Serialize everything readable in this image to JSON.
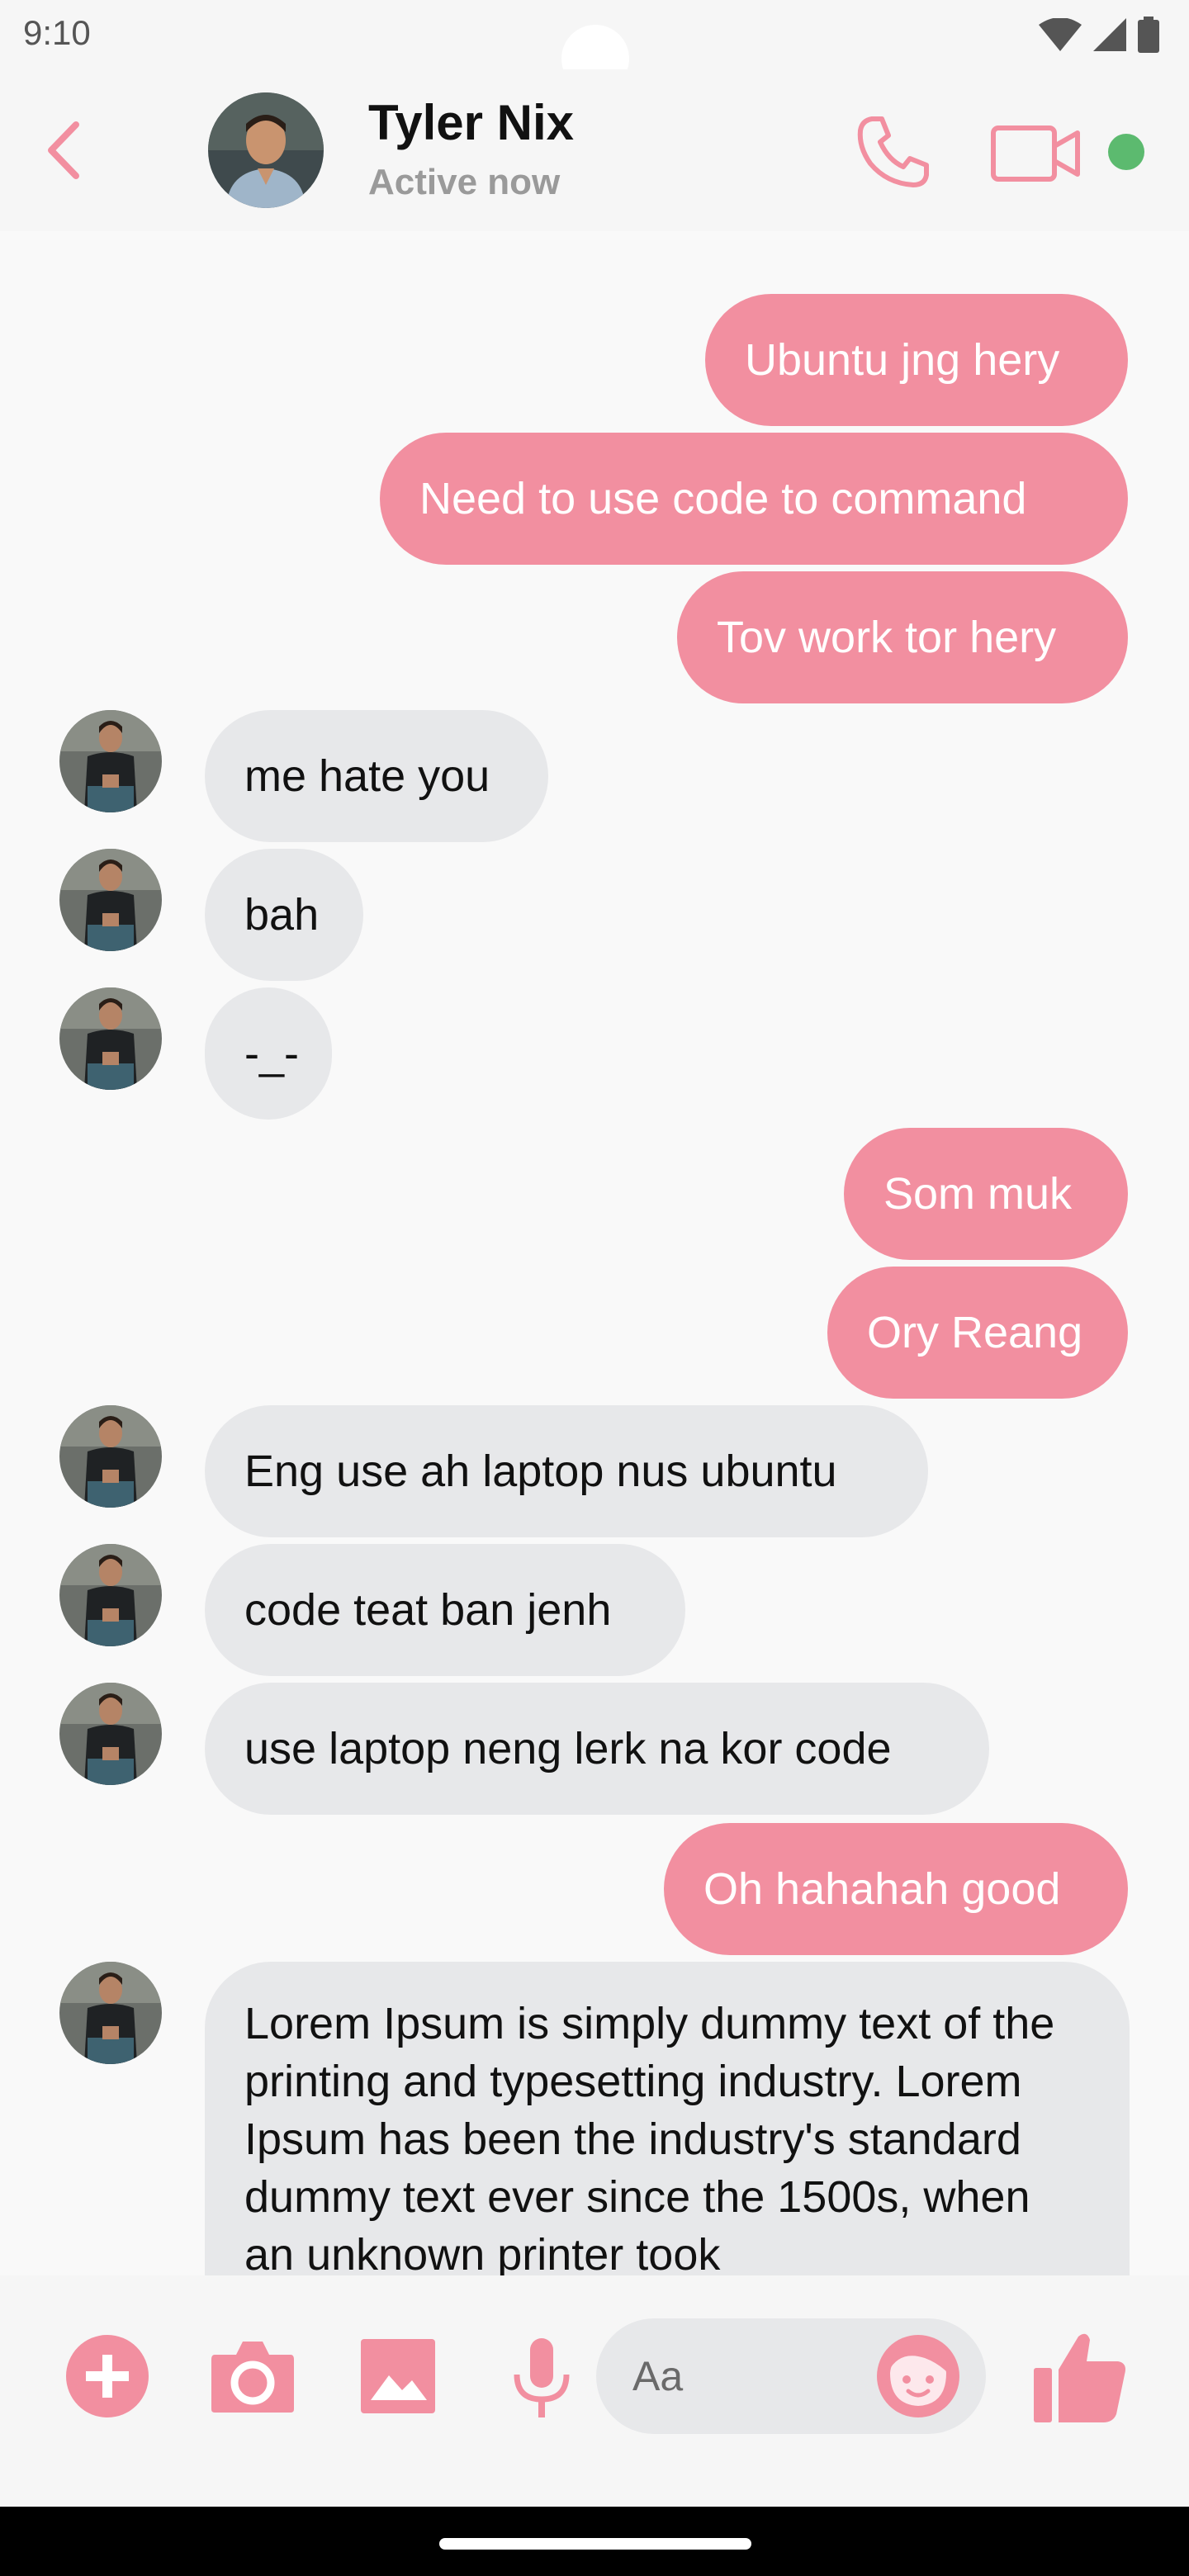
{
  "status_bar": {
    "time": "9:10"
  },
  "header": {
    "contact_name": "Tyler Nix",
    "contact_status": "Active now",
    "accent_color": "#f28fa0",
    "online_color": "#5cba6f"
  },
  "messages": [
    {
      "direction": "outgoing",
      "text": "Ubuntu jng hery"
    },
    {
      "direction": "outgoing",
      "text": "Need to use code to command"
    },
    {
      "direction": "outgoing",
      "text": "Tov work tor hery"
    },
    {
      "direction": "incoming",
      "text": "me hate you"
    },
    {
      "direction": "incoming",
      "text": "bah"
    },
    {
      "direction": "incoming",
      "text": "-_-"
    },
    {
      "direction": "outgoing",
      "text": "Som muk"
    },
    {
      "direction": "outgoing",
      "text": "Ory Reang"
    },
    {
      "direction": "incoming",
      "text": "Eng use ah laptop nus ubuntu"
    },
    {
      "direction": "incoming",
      "text": "code teat ban jenh"
    },
    {
      "direction": "incoming",
      "text": "use laptop neng lerk na kor code"
    },
    {
      "direction": "outgoing",
      "text": "Oh hahahah good"
    },
    {
      "direction": "incoming",
      "text": "Lorem Ipsum is simply dummy text of the printing and typesetting industry. Lorem Ipsum has been the industry's standard dummy text ever since the 1500s, when an unknown printer took"
    }
  ],
  "composer": {
    "placeholder": "Aa",
    "icons": [
      "add-circle-icon",
      "camera-icon",
      "image-icon",
      "microphone-icon",
      "emoji-icon",
      "thumbs-up-icon"
    ]
  },
  "colors": {
    "outgoing_bubble": "#f28fa0",
    "incoming_bubble": "#e7e8ea",
    "background": "#f9f9f9"
  }
}
